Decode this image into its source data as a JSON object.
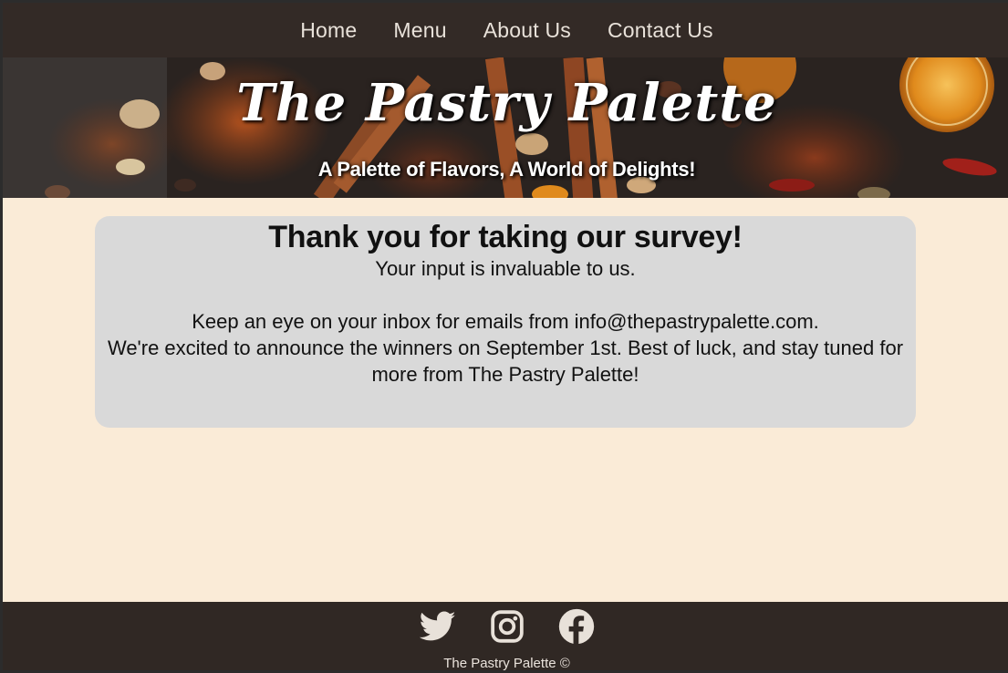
{
  "nav": {
    "items": [
      {
        "label": "Home"
      },
      {
        "label": "Menu"
      },
      {
        "label": "About Us"
      },
      {
        "label": "Contact Us"
      }
    ]
  },
  "hero": {
    "title": "The Pastry Palette",
    "tagline": "A Palette of Flavors, A World of Delights!"
  },
  "main": {
    "heading": "Thank you for taking our survey!",
    "line1": "Your input is invaluable to us.",
    "line2": "Keep an eye on your inbox for emails from info@thepastrypalette.com.",
    "line3": "We're excited to announce the winners on September 1st. Best of luck, and stay tuned for more from The Pastry Palette!"
  },
  "footer": {
    "social": [
      {
        "icon": "twitter-icon"
      },
      {
        "icon": "instagram-icon"
      },
      {
        "icon": "facebook-icon"
      }
    ],
    "copyright": "The Pastry Palette ©"
  },
  "colors": {
    "nav_bg": "#332a26",
    "main_bg": "#faebd7",
    "card_bg": "#d9d9d9",
    "footer_bg": "#302824"
  }
}
